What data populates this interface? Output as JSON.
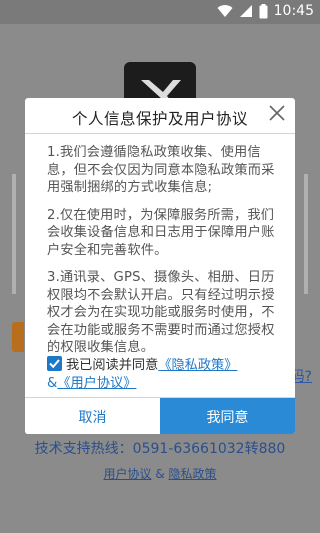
{
  "status_bar": {
    "time": "10:45",
    "icons": [
      "wifi-icon",
      "signal-icon",
      "battery-icon"
    ]
  },
  "background_app": {
    "forgot_password_fragment": "码?",
    "hotline": "技术支持热线：0591-63661032转880",
    "footer_links": {
      "user_agreement": "用户协议",
      "separator": "&",
      "privacy_policy": "隐私政策"
    }
  },
  "dialog": {
    "title": "个人信息保护及用户协议",
    "paragraphs": [
      "1.我们会遵循隐私政策收集、使用信息，但不会仅因为同意本隐私政策而采用强制捆绑的方式收集信息;",
      "2.仅在使用时，为保障服务所需，我们会收集设备信息和日志用于保障用户账户安全和完善软件。",
      "3.通讯录、GPS、摄像头、相册、日历权限均不会默认开启。只有经过明示授权才会为在实现功能或服务时使用，不会在功能或服务不需要时而通过您授权的权限收集信息。"
    ],
    "agree": {
      "checked": true,
      "text": "我已阅读并同意",
      "privacy_link": "《隐私政策》",
      "amp": "&",
      "user_agreement_link": "《用户协议》"
    },
    "buttons": {
      "cancel": "取消",
      "agree": "我同意"
    }
  },
  "colors": {
    "accent": "#1e78c8",
    "agree_button": "#2b8ad6",
    "overlay": "#8a8a8a",
    "brand_orange": "#b86e1d"
  }
}
